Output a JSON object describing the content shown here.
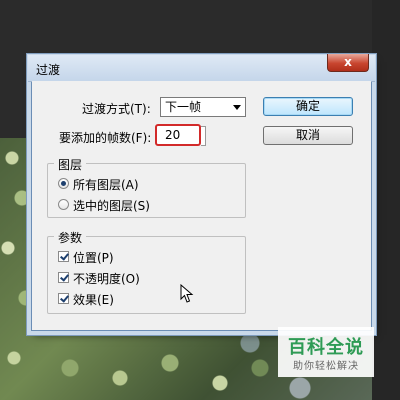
{
  "dialog": {
    "title": "过渡",
    "close_glyph": "x",
    "transition_label": "过渡方式(T):",
    "transition_value": "下一帧",
    "frames_label": "要添加的帧数(F):",
    "frames_value": "20",
    "ok_label": "确定",
    "cancel_label": "取消",
    "layers": {
      "legend": "图层",
      "options": [
        {
          "label": "所有图层(A)",
          "selected": true
        },
        {
          "label": "选中的图层(S)",
          "selected": false
        }
      ]
    },
    "params": {
      "legend": "参数",
      "options": [
        {
          "label": "位置(P)",
          "checked": true
        },
        {
          "label": "不透明度(O)",
          "checked": true
        },
        {
          "label": "效果(E)",
          "checked": true
        }
      ]
    }
  },
  "watermark": {
    "title": "百科全说",
    "subtitle": "助你轻松解决"
  }
}
